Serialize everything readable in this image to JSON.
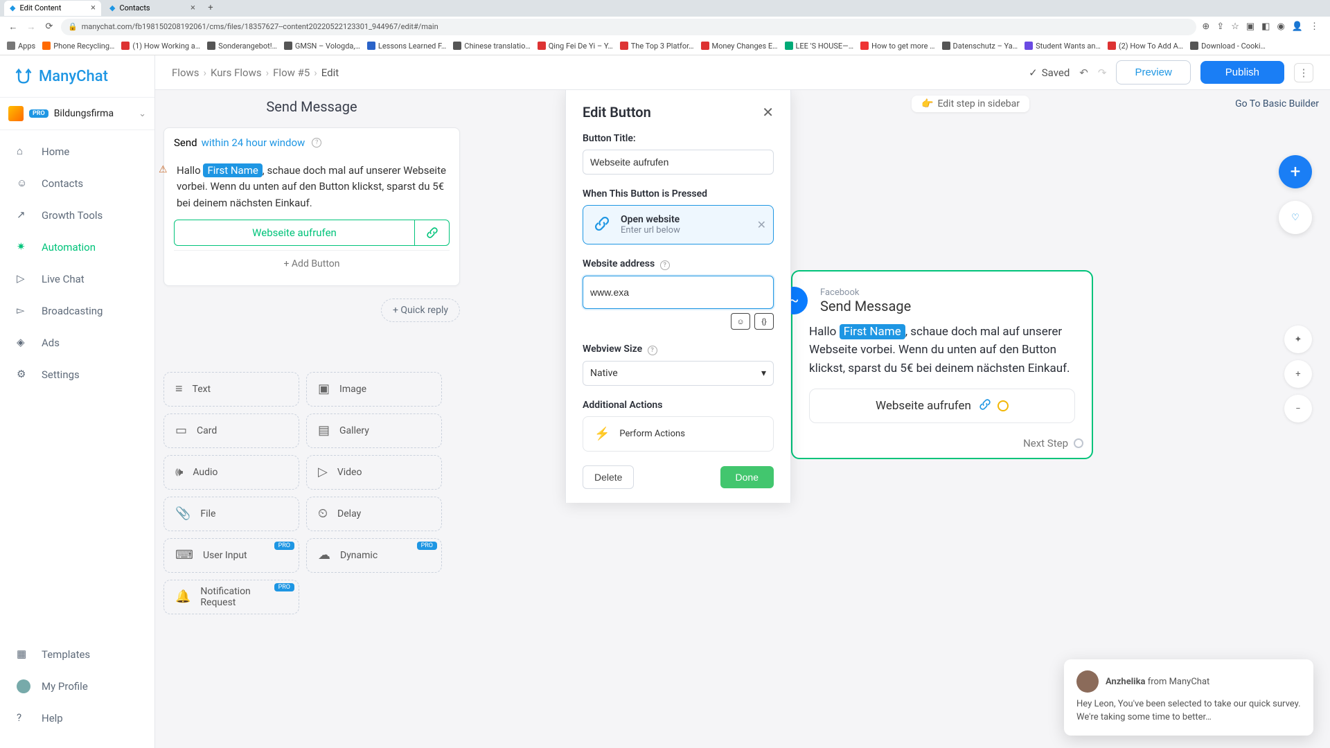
{
  "browser": {
    "tabs": [
      {
        "title": "Edit Content",
        "active": true
      },
      {
        "title": "Contacts",
        "active": false
      }
    ],
    "url": "manychat.com/fb198150208192061/cms/files/18357627--content20220522123301_944967/edit#/main",
    "bookmarks": [
      {
        "label": "Apps",
        "color": "#777"
      },
      {
        "label": "Phone Recycling…",
        "color": "#ff6a00"
      },
      {
        "label": "(1) How Working a…",
        "color": "#d33"
      },
      {
        "label": "Sonderangebot!…",
        "color": "#555"
      },
      {
        "label": "GMSN – Vologda,…",
        "color": "#555"
      },
      {
        "label": "Lessons Learned F…",
        "color": "#2a63c8"
      },
      {
        "label": "Chinese translatio…",
        "color": "#555"
      },
      {
        "label": "Qing Fei De Yi – Y…",
        "color": "#d33"
      },
      {
        "label": "The Top 3 Platfor…",
        "color": "#d33"
      },
      {
        "label": "Money Changes E…",
        "color": "#d33"
      },
      {
        "label": "LEE 'S HOUSE—…",
        "color": "#0a7"
      },
      {
        "label": "How to get more …",
        "color": "#e33"
      },
      {
        "label": "Datenschutz – Ya…",
        "color": "#555"
      },
      {
        "label": "Student Wants an…",
        "color": "#6a4ae3"
      },
      {
        "label": "(2) How To Add A…",
        "color": "#d33"
      },
      {
        "label": "Download - Cooki…",
        "color": "#555"
      }
    ]
  },
  "brand": "ManyChat",
  "account": {
    "name": "Bildungsfirma",
    "plan": "PRO"
  },
  "nav": {
    "items": [
      {
        "label": "Home"
      },
      {
        "label": "Contacts"
      },
      {
        "label": "Growth Tools"
      },
      {
        "label": "Automation"
      },
      {
        "label": "Live Chat"
      },
      {
        "label": "Broadcasting"
      },
      {
        "label": "Ads"
      },
      {
        "label": "Settings"
      }
    ],
    "bottom": [
      {
        "label": "Templates"
      },
      {
        "label": "My Profile"
      },
      {
        "label": "Help"
      }
    ]
  },
  "crumbs": [
    "Flows",
    "Kurs Flows",
    "Flow #5",
    "Edit"
  ],
  "actions": {
    "saved": "Saved",
    "preview": "Preview",
    "publish": "Publish"
  },
  "canvas": {
    "edit_sidebar_label": "Edit step in sidebar",
    "go_basic": "Go To Basic Builder"
  },
  "compose": {
    "title": "Send Message",
    "send_prefix": "Send",
    "send_link": "within 24 hour window",
    "greeting_prefix": "Hallo ",
    "chip": "First Name",
    "msg_rest": ", schaue doch mal auf unserer Webseite vorbei. Wenn du unten auf den Button klickst, sparst du 5€ bei deinem nächsten Einkauf.",
    "button_label": "Webseite aufrufen",
    "add_button": "+ Add Button",
    "quick_reply": "+ Quick reply",
    "tiles": [
      {
        "label": "Text"
      },
      {
        "label": "Image"
      },
      {
        "label": "Card"
      },
      {
        "label": "Gallery"
      },
      {
        "label": "Audio"
      },
      {
        "label": "Video"
      },
      {
        "label": "File"
      },
      {
        "label": "Delay"
      },
      {
        "label": "User Input",
        "pro": true
      },
      {
        "label": "Dynamic",
        "pro": true
      },
      {
        "label": "Notification Request",
        "pro": true
      }
    ]
  },
  "node": {
    "subtitle": "Facebook",
    "title": "Send Message",
    "greeting_prefix": "Hallo ",
    "chip": "First Name",
    "msg_rest": ", schaue doch mal auf unserer Webseite vorbei. Wenn du unten auf den Button klickst, sparst du 5€ bei deinem nächsten Einkauf.",
    "button_label": "Webseite aufrufen",
    "next_step": "Next Step"
  },
  "modal": {
    "title": "Edit Button",
    "button_title_label": "Button Title:",
    "button_title_value": "Webseite aufrufen",
    "when_pressed": "When This Button is Pressed",
    "action_title": "Open website",
    "action_sub": "Enter url below",
    "url_label": "Website address",
    "url_value": "www.exa",
    "webview_label": "Webview Size",
    "webview_value": "Native",
    "additional_label": "Additional Actions",
    "perform_label": "Perform Actions",
    "delete": "Delete",
    "done": "Done"
  },
  "toast": {
    "name": "Anzhelika",
    "from": " from ManyChat",
    "body": "Hey Leon,  You've been selected to take our quick survey. We're taking some time to better…"
  }
}
